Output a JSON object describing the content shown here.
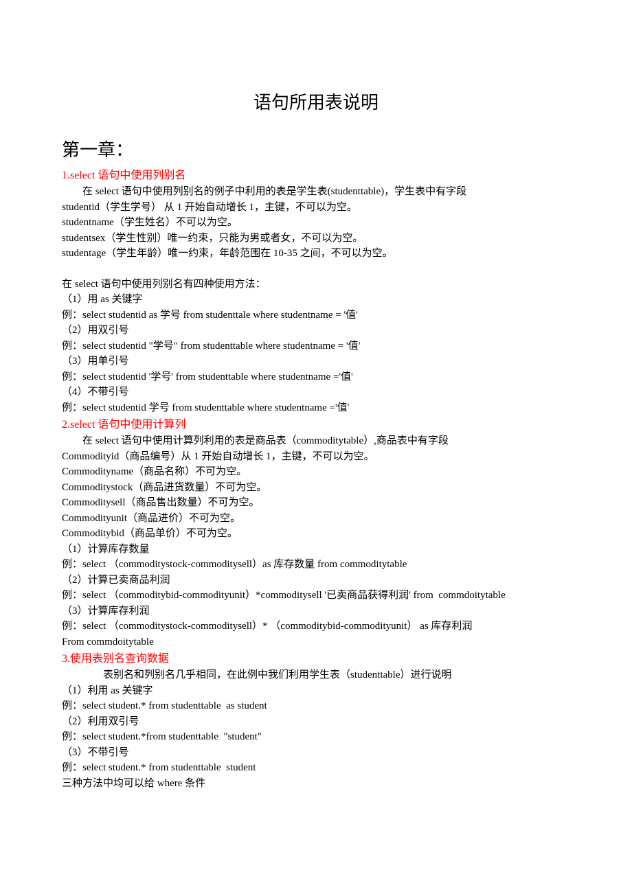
{
  "title": "语句所用表说明",
  "chapter": "第一章：",
  "sec1": {
    "heading": "1.select 语句中使用列别名",
    "p0": "在 select 语句中使用列别名的例子中利用的表是学生表(studenttable)，学生表中有字段",
    "p1": "studentid（学生学号） 从 1 开始自动增长 1，主键，不可以为空。",
    "p2": "studentname（学生姓名）不可以为空。",
    "p3": "studentsex（学生性别）唯一约束，只能为男或者女，不可以为空。",
    "p4": "studentage（学生年龄）唯一约束，年龄范围在 10-35 之间，不可以为空。",
    "p5": "在 select 语句中使用列别名有四种使用方法：",
    "p6": "（1）用 as 关键字",
    "p7": "例：select studentid as 学号 from studenttale where studentname = '值'",
    "p8": "（2）用双引号",
    "p9": "例：select studentid \"学号\" from studenttable where studentname = '值'",
    "p10": "（3）用单引号",
    "p11": "例：select studentid '学号' from studenttable where studentname ='值'",
    "p12": "（4）不带引号",
    "p13": "例：select studentid 学号 from studenttable where studentname ='值'"
  },
  "sec2": {
    "heading": "2.select 语句中使用计算列",
    "p0": "在 select 语句中使用计算列利用的表是商品表（commoditytable）,商品表中有字段",
    "p1": "Commodityid（商品编号）从 1 开始自动增长 1，主键，不可以为空。",
    "p2": "Commodityname（商品名称）不可为空。",
    "p3": "Commoditystock（商品进货数量）不可为空。",
    "p4": "Commoditysell（商品售出数量）不可为空。",
    "p5": "Commodityunit（商品进价）不可为空。",
    "p6": "Commoditybid（商品单价）不可为空。",
    "p7": "（1）计算库存数量",
    "p8": "例：select （commoditystock-commoditysell）as 库存数量 from commoditytable",
    "p9": "（2）计算已卖商品利润",
    "p10": "例：select （commoditybid-commodityunit）*commoditysell '已卖商品获得利润' from  commdoitytable",
    "p11": "（3）计算库存利润",
    "p12": "例：select （commoditystock-commoditysell）* （commoditybid-commodityunit） as 库存利润",
    "p13": "From commdoitytable"
  },
  "sec3": {
    "heading": "3.使用表别名查询数据",
    "p0": "表别名和列别名几乎相同，在此例中我们利用学生表（studenttable）进行说明",
    "p1": "（1）利用 as 关键字",
    "p2": "例：select student.* from studenttable  as student",
    "p3": "（2）利用双引号",
    "p4": "例：select student.*from studenttable  \"student\"",
    "p5": "（3）不带引号",
    "p6": "例：select student.* from studenttable  student",
    "p7": "三种方法中均可以给 where 条件"
  }
}
